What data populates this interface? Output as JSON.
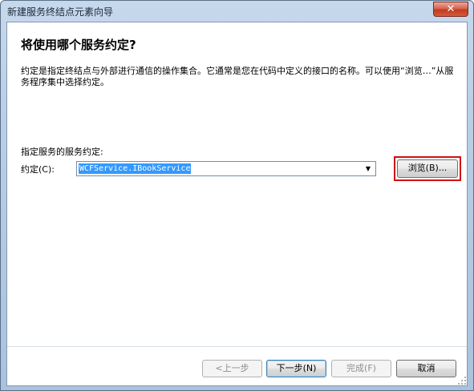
{
  "window": {
    "title": "新建服务终结点元素向导",
    "close_glyph": "✕"
  },
  "page": {
    "heading": "将使用哪个服务约定?",
    "description": "约定是指定终结点与外部进行通信的操作集合。它通常是您在代码中定义的接口的名称。可以使用“浏览…”从服务程序集中选择约定。"
  },
  "contract": {
    "section_label": "指定服务的服务约定:",
    "field_label": "约定(C):",
    "value": "WCFService.IBookService",
    "dropdown_arrow": "▼",
    "browse_label": "浏览(B)..."
  },
  "footer": {
    "back_label": "<上一步",
    "next_label": "下一步(N)",
    "finish_label": "完成(F)",
    "cancel_label": "取消"
  },
  "colors": {
    "highlight_border": "#d01010",
    "selection": "#3399ff",
    "close_button": "#c23a22"
  }
}
